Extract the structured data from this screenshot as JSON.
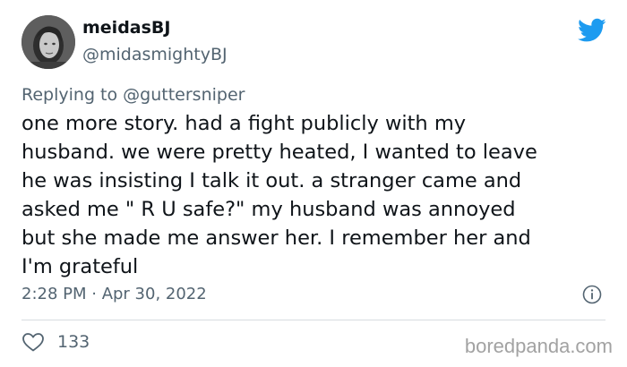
{
  "author": {
    "name": "meidasBJ",
    "handle": "@midasmightyBJ"
  },
  "icons": {
    "platform": "twitter-bird-icon",
    "info": "info-icon",
    "like": "heart-icon"
  },
  "colors": {
    "brand": "#1d9bf0",
    "text": "#0f1419",
    "secondary_text": "#536471",
    "watermark": "#a2a2a2"
  },
  "reply": {
    "prefix": "Replying to",
    "mention": "@guttersniper"
  },
  "tweet": {
    "text": "one more story. had a fight publicly with my\nhusband. we were pretty heated, I wanted to leave\nhe was insisting I talk it out. a stranger came and\nasked  me \" R U safe?\" my husband was annoyed\nbut she made me answer her. I remember her and\nI'm grateful",
    "timestamp": "2:28 PM · Apr 30, 2022"
  },
  "stats": {
    "likes": "133"
  },
  "watermark": "boredpanda.com"
}
